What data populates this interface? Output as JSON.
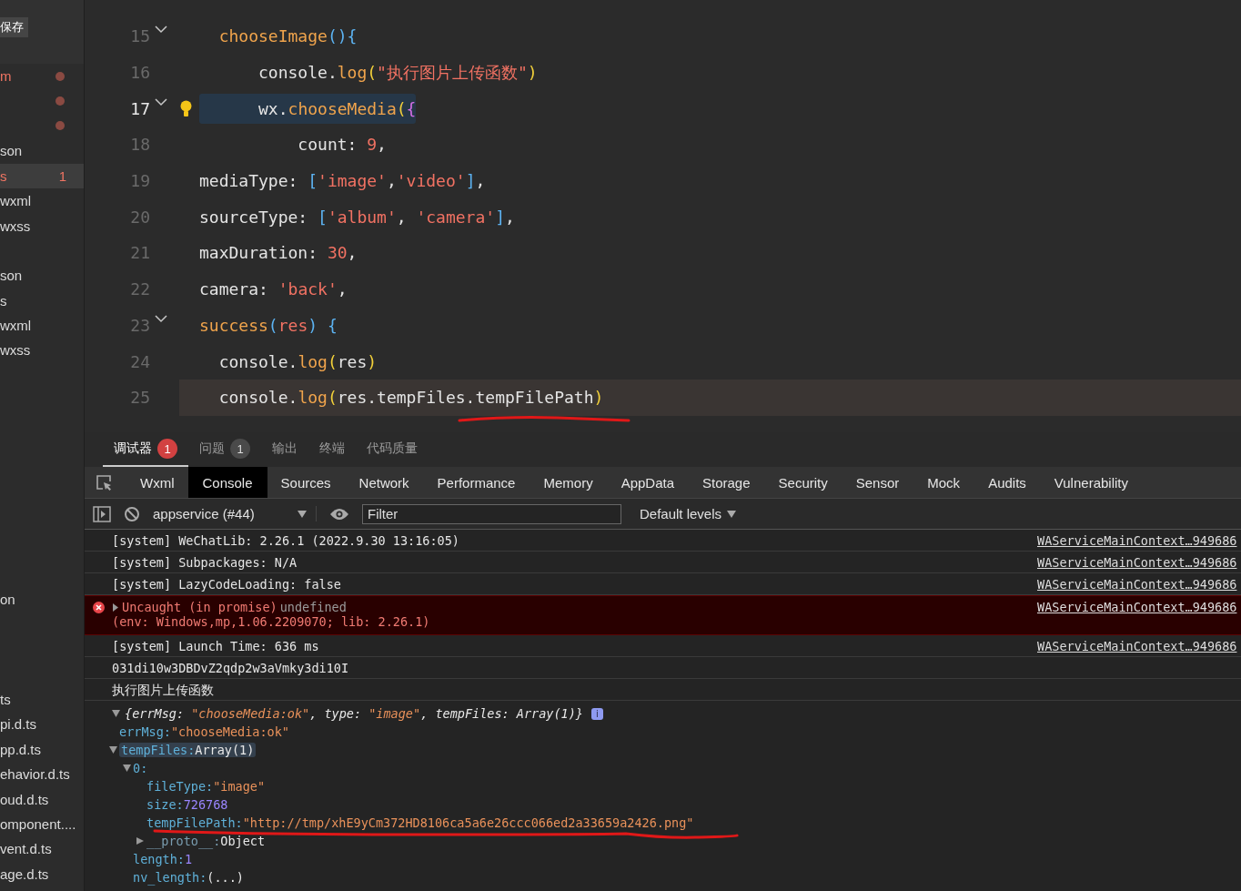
{
  "sidebar": {
    "save_button": "保存",
    "rows": [
      {
        "kind": "file",
        "text": "m",
        "error": true,
        "modified": true
      },
      {
        "kind": "file",
        "modified": true
      },
      {
        "kind": "file",
        "modified": true
      },
      {
        "kind": "file",
        "text": "son"
      },
      {
        "kind": "file",
        "text": "s",
        "error": true,
        "selected": true,
        "badge": "1"
      },
      {
        "kind": "file",
        "text": "wxml"
      },
      {
        "kind": "file",
        "text": "wxss"
      },
      {
        "kind": "blank"
      },
      {
        "kind": "file",
        "text": "son"
      },
      {
        "kind": "file",
        "text": "s"
      },
      {
        "kind": "file",
        "text": "wxml"
      },
      {
        "kind": "file",
        "text": "wxss"
      },
      {
        "kind": "blank"
      },
      {
        "kind": "blank"
      },
      {
        "kind": "blank"
      },
      {
        "kind": "blank"
      },
      {
        "kind": "blank"
      },
      {
        "kind": "blank"
      },
      {
        "kind": "blank"
      },
      {
        "kind": "blank"
      },
      {
        "kind": "blank"
      },
      {
        "kind": "file",
        "text": "on"
      },
      {
        "kind": "blank"
      },
      {
        "kind": "blank"
      },
      {
        "kind": "blank"
      },
      {
        "kind": "file",
        "text": "ts"
      },
      {
        "kind": "file",
        "text": "pi.d.ts"
      },
      {
        "kind": "file",
        "text": "pp.d.ts"
      },
      {
        "kind": "file",
        "text": "ehavior.d.ts"
      },
      {
        "kind": "file",
        "text": "oud.d.ts"
      },
      {
        "kind": "file",
        "text": "omponent...."
      },
      {
        "kind": "file",
        "text": "vent.d.ts"
      },
      {
        "kind": "file",
        "text": "age.d.ts"
      }
    ]
  },
  "editor": {
    "lines": [
      {
        "number": "15",
        "foldable": true,
        "tokens": [
          {
            "t": "  chooseImage",
            "kind": "fn"
          },
          {
            "t": "()",
            "kind": "bracket"
          },
          {
            "t": "{",
            "kind": "bracket"
          }
        ]
      },
      {
        "number": "16",
        "tokens": [
          {
            "t": "      console.",
            "kind": "plain"
          },
          {
            "t": "log",
            "kind": "fn"
          },
          {
            "t": "(",
            "kind": "paren"
          },
          {
            "t": "\"执行图片上传函数\"",
            "kind": "str"
          },
          {
            "t": ")",
            "kind": "paren"
          }
        ]
      },
      {
        "number": "17",
        "foldable": true,
        "active": true,
        "bulb": true,
        "highlighted": true,
        "tokens": [
          {
            "t": "      wx.",
            "kind": "plain"
          },
          {
            "t": "chooseMedia",
            "kind": "fn"
          },
          {
            "t": "(",
            "kind": "paren"
          },
          {
            "t": "{",
            "kind": "brace"
          }
        ]
      },
      {
        "number": "18",
        "tokens": [
          {
            "t": "          count: ",
            "kind": "plain"
          },
          {
            "t": "9",
            "kind": "num"
          },
          {
            "t": ",",
            "kind": "plain"
          }
        ]
      },
      {
        "number": "19",
        "tokens": [
          {
            "t": "mediaType: ",
            "kind": "plain"
          },
          {
            "t": "[",
            "kind": "bracket"
          },
          {
            "t": "'image'",
            "kind": "str"
          },
          {
            "t": ",",
            "kind": "plain"
          },
          {
            "t": "'video'",
            "kind": "str"
          },
          {
            "t": "]",
            "kind": "bracket"
          },
          {
            "t": ",",
            "kind": "plain"
          }
        ]
      },
      {
        "number": "20",
        "tokens": [
          {
            "t": "sourceType: ",
            "kind": "plain"
          },
          {
            "t": "[",
            "kind": "bracket"
          },
          {
            "t": "'album'",
            "kind": "str"
          },
          {
            "t": ", ",
            "kind": "plain"
          },
          {
            "t": "'camera'",
            "kind": "str"
          },
          {
            "t": "]",
            "kind": "bracket"
          },
          {
            "t": ",",
            "kind": "plain"
          }
        ]
      },
      {
        "number": "21",
        "tokens": [
          {
            "t": "maxDuration: ",
            "kind": "plain"
          },
          {
            "t": "30",
            "kind": "num"
          },
          {
            "t": ",",
            "kind": "plain"
          }
        ]
      },
      {
        "number": "22",
        "tokens": [
          {
            "t": "camera: ",
            "kind": "plain"
          },
          {
            "t": "'back'",
            "kind": "str"
          },
          {
            "t": ",",
            "kind": "plain"
          }
        ]
      },
      {
        "number": "23",
        "foldable": true,
        "tokens": [
          {
            "t": "success",
            "kind": "fn"
          },
          {
            "t": "(",
            "kind": "bracket"
          },
          {
            "t": "res",
            "kind": "str"
          },
          {
            "t": ")",
            "kind": "bracket"
          },
          {
            "t": " {",
            "kind": "bracket"
          }
        ]
      },
      {
        "number": "24",
        "tokens": [
          {
            "t": "  console.",
            "kind": "plain"
          },
          {
            "t": "log",
            "kind": "fn"
          },
          {
            "t": "(",
            "kind": "paren"
          },
          {
            "t": "res",
            "kind": "plain"
          },
          {
            "t": ")",
            "kind": "paren"
          }
        ]
      },
      {
        "number": "25",
        "current": true,
        "tokens": [
          {
            "t": "  console.",
            "kind": "plain"
          },
          {
            "t": "log",
            "kind": "fn"
          },
          {
            "t": "(",
            "kind": "paren"
          },
          {
            "t": "res.tempFiles.tempFilePath",
            "kind": "plain"
          },
          {
            "t": ")",
            "kind": "paren"
          }
        ]
      }
    ]
  },
  "panel_tabs": [
    {
      "label": "调试器",
      "selected": true,
      "badge": "1",
      "badge_alert": true
    },
    {
      "label": "问题",
      "selected": false,
      "badge": "1",
      "badge_alert": false
    },
    {
      "label": "输出",
      "selected": false
    },
    {
      "label": "终端",
      "selected": false
    },
    {
      "label": "代码质量",
      "selected": false
    }
  ],
  "devtools_tabs": [
    {
      "label": "Wxml",
      "selected": false
    },
    {
      "label": "Console",
      "selected": true
    },
    {
      "label": "Sources",
      "selected": false
    },
    {
      "label": "Network",
      "selected": false
    },
    {
      "label": "Performance",
      "selected": false
    },
    {
      "label": "Memory",
      "selected": false
    },
    {
      "label": "AppData",
      "selected": false
    },
    {
      "label": "Storage",
      "selected": false
    },
    {
      "label": "Security",
      "selected": false
    },
    {
      "label": "Sensor",
      "selected": false
    },
    {
      "label": "Mock",
      "selected": false
    },
    {
      "label": "Audits",
      "selected": false
    },
    {
      "label": "Vulnerability",
      "selected": false
    }
  ],
  "console_toolbar": {
    "context": "appservice (#44)",
    "filter": {
      "placeholder": "Filter"
    },
    "levels": "Default levels"
  },
  "messages": [
    {
      "kind": "log",
      "text": "[system] WeChatLib: 2.26.1 (2022.9.30 13:16:05)",
      "source": "WAServiceMainContext…949686"
    },
    {
      "kind": "log",
      "text": "[system] Subpackages: N/A",
      "source": "WAServiceMainContext…949686"
    },
    {
      "kind": "log",
      "text": "[system] LazyCodeLoading: false",
      "source": "WAServiceMainContext…949686"
    },
    {
      "kind": "error",
      "text": "Uncaught (in promise)",
      "value": "undefined",
      "detail": "(env: Windows,mp,1.06.2209070; lib: 2.26.1)",
      "source": "WAServiceMainContext…949686"
    },
    {
      "kind": "log",
      "text": "[system] Launch Time: 636 ms",
      "source": "WAServiceMainContext…949686"
    },
    {
      "kind": "log",
      "text": "031di10w3DBDvZ2qdp2w3aVmky3di10I"
    },
    {
      "kind": "log",
      "text": "执行图片上传函数"
    }
  ],
  "object_tree": {
    "expanded": true,
    "info_badge": "i",
    "summary": [
      {
        "t": "{errMsg: ",
        "kind": "plain"
      },
      {
        "t": "\"chooseMedia:ok\"",
        "kind": "str"
      },
      {
        "t": ", type: ",
        "kind": "plain"
      },
      {
        "t": "\"image\"",
        "kind": "str"
      },
      {
        "t": ", tempFiles: Array(1)}",
        "kind": "plain"
      }
    ],
    "children": [
      {
        "key": "errMsg:",
        "value": "\"chooseMedia:ok\"",
        "kind": "str"
      },
      {
        "key": "tempFiles:",
        "value": "Array(1)",
        "kind": "plain",
        "expanded": true,
        "highlighted": true,
        "children": [
          {
            "key": "0:",
            "expanded": true,
            "children": [
              {
                "key": "fileType:",
                "value": "\"image\"",
                "kind": "str"
              },
              {
                "key": "size:",
                "value": "726768",
                "kind": "num"
              },
              {
                "key": "tempFilePath:",
                "value": "\"http://tmp/xhE9yCm372HD8106ca5a6e26ccc066ed2a33659a2426.png\"",
                "kind": "url"
              },
              {
                "key": "__proto__:",
                "value": "Object",
                "kind": "plain",
                "expanded": false,
                "internal": true
              }
            ]
          },
          {
            "key": "length:",
            "value": "1",
            "kind": "num"
          },
          {
            "key": "nv_length:",
            "value": "(...)",
            "kind": "plain"
          }
        ]
      }
    ]
  }
}
